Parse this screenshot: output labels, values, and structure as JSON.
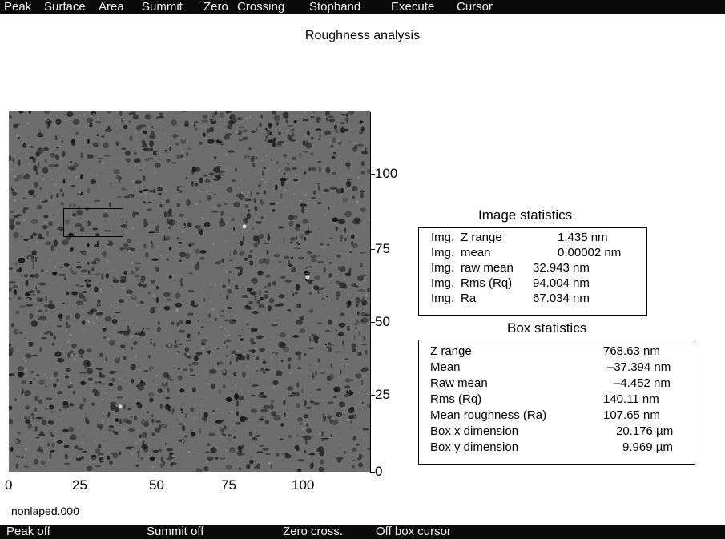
{
  "menubar": {
    "items": [
      "Peak",
      "Surface",
      "Area",
      "Summit",
      "Zero",
      "Crossing",
      "Stopband",
      "Execute",
      "Cursor"
    ]
  },
  "title": "Roughness analysis",
  "image_axes": {
    "x_ticks": [
      "0",
      "25",
      "50",
      "75",
      "100"
    ],
    "y_ticks": [
      "100",
      "75",
      "50",
      "25",
      "0"
    ]
  },
  "colors": {
    "bars": "#0a0a0a",
    "bar_text": "#f2f2f2",
    "surface_base": "#6d6d6d",
    "surface_pits": "#1c1c1c"
  },
  "image_statistics": {
    "title": "Image statistics",
    "rows": [
      {
        "prefix": "Img.",
        "label": "Z range",
        "value": "1.435 nm"
      },
      {
        "prefix": "Img.",
        "label": "mean",
        "value": "0.00002 nm"
      },
      {
        "prefix": "Img.",
        "label": "raw mean",
        "value": "32.943 nm"
      },
      {
        "prefix": "Img.",
        "label": "Rms (Rq)",
        "value": "94.004 nm"
      },
      {
        "prefix": "Img.",
        "label": "Ra",
        "value": "67.034 nm"
      }
    ]
  },
  "box_statistics": {
    "title": "Box statistics",
    "rows": [
      {
        "label": "Z range",
        "value": "768.63 nm"
      },
      {
        "label": "Mean",
        "value": "–37.394 nm"
      },
      {
        "label": "Raw mean",
        "value": "–4.452 nm"
      },
      {
        "label": "Rms (Rq)",
        "value": "140.11 nm"
      },
      {
        "label": "Mean roughness (Ra)",
        "value": "107.65 nm"
      },
      {
        "label": "Box x dimension",
        "value": "20.176 µm"
      },
      {
        "label": "Box y dimension",
        "value": "9.969 µm"
      }
    ]
  },
  "filename": "nonlaped.000",
  "statusbar": {
    "items": [
      "Peak off",
      "Summit off",
      "Zero cross.",
      "Off box cursor"
    ]
  }
}
